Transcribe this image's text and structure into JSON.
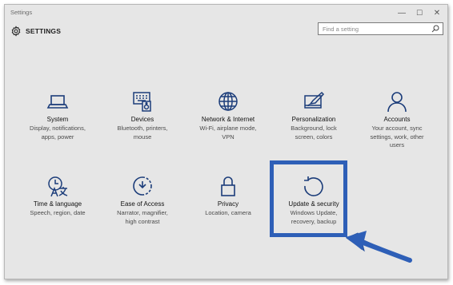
{
  "window": {
    "title": "Settings",
    "controls": {
      "minimize": "—",
      "maximize": "☐",
      "close": "✕"
    }
  },
  "header": {
    "title": "SETTINGS",
    "icon": "gear-icon"
  },
  "search": {
    "placeholder": "Find a setting",
    "value": "",
    "icon": "search-icon"
  },
  "tiles": [
    {
      "id": "system",
      "icon": "laptop-icon",
      "name": "System",
      "desc": "Display, notifications,\napps, power"
    },
    {
      "id": "devices",
      "icon": "devices-icon",
      "name": "Devices",
      "desc": "Bluetooth, printers,\nmouse"
    },
    {
      "id": "network",
      "icon": "globe-icon",
      "name": "Network & Internet",
      "desc": "Wi-Fi, airplane mode,\nVPN"
    },
    {
      "id": "personalization",
      "icon": "paint-icon",
      "name": "Personalization",
      "desc": "Background, lock\nscreen, colors"
    },
    {
      "id": "accounts",
      "icon": "person-icon",
      "name": "Accounts",
      "desc": "Your account, sync\nsettings, work, other\nusers"
    },
    {
      "id": "time",
      "icon": "time-language-icon",
      "name": "Time & language",
      "desc": "Speech, region, date"
    },
    {
      "id": "ease",
      "icon": "ease-of-access-icon",
      "name": "Ease of Access",
      "desc": "Narrator, magnifier,\nhigh contrast"
    },
    {
      "id": "privacy",
      "icon": "lock-icon",
      "name": "Privacy",
      "desc": "Location, camera"
    },
    {
      "id": "update",
      "icon": "refresh-icon",
      "name": "Update & security",
      "desc": "Windows Update,\nrecovery, backup"
    }
  ],
  "colors": {
    "accent": "#1c3d7a",
    "highlight": "#2e5fb7",
    "background": "#e6e6e6"
  }
}
